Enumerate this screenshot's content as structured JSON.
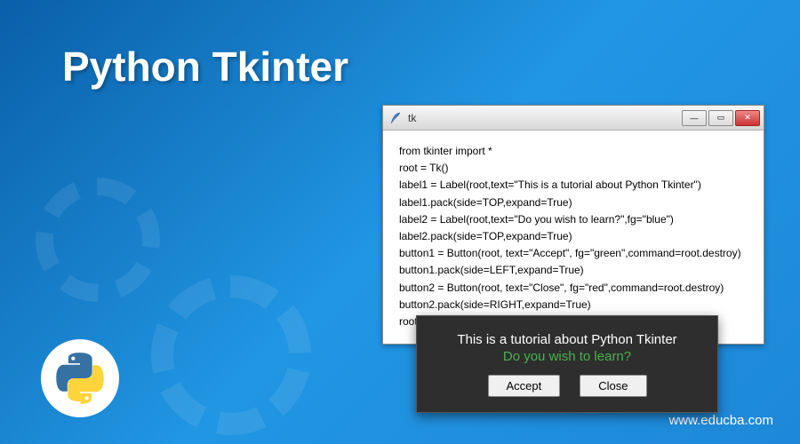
{
  "page": {
    "title": "Python Tkinter",
    "url": "www.educba.com"
  },
  "tk_window": {
    "title": "tk",
    "code": [
      "from tkinter import *",
      "root = Tk()",
      "label1 = Label(root,text=\"This is a tutorial about Python Tkinter\")",
      "label1.pack(side=TOP,expand=True)",
      "label2 = Label(root,text=\"Do you wish to learn?\",fg=\"blue\")",
      "label2.pack(side=TOP,expand=True)",
      "button1 = Button(root, text=\"Accept\", fg=\"green\",command=root.destroy)",
      "button1.pack(side=LEFT,expand=True)",
      "button2 = Button(root, text=\"Close\", fg=\"red\",command=root.destroy)",
      "button2.pack(side=RIGHT,expand=True)",
      "root.mainloop()"
    ]
  },
  "dialog": {
    "line1": "This is a tutorial about Python Tkinter",
    "line2": "Do you wish to learn?",
    "accept_label": "Accept",
    "close_label": "Close"
  },
  "win_controls": {
    "minimize": "—",
    "maximize": "▭",
    "close": "✕"
  }
}
